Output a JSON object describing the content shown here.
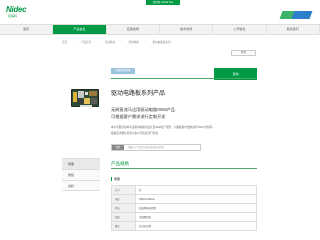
{
  "header": {
    "logo": "Nidec",
    "logo_sub": "尼得科",
    "site_badge": "尼得科 Global Site"
  },
  "nav": {
    "items": [
      {
        "label": "首页",
        "active": false
      },
      {
        "label": "产品信息",
        "active": true
      },
      {
        "label": "应用案例",
        "active": false
      },
      {
        "label": "技术支持",
        "active": false
      },
      {
        "label": "公司信息",
        "active": false
      },
      {
        "label": "联系我们",
        "active": false
      }
    ]
  },
  "breadcrumb": [
    "首页",
    "产品信息",
    "马达驱动",
    "控制电路",
    "驱动电路板系列"
  ],
  "toolbar": {
    "print_label": "打印"
  },
  "product": {
    "category_tag": "控制电路基板",
    "inquiry_label": "咨询",
    "title": "驱动电路板系列产品",
    "headline_1": "无刷直流马达用驱动电路OEM产品",
    "headline_2": "可根据客户需求进行定制开发",
    "desc_1": "本公司提供各种马达驱动电路的设计及OEM生产服务，可根据客户要求进行PWM 控制等。",
    "desc_2": "规格及详细信息请与本公司营业部门咨询。",
    "image_icon": "circuit-board-photo"
  },
  "search": {
    "button_label": "检索",
    "placeholder": "请输入产品型号或关键词进行检索"
  },
  "side_menu": {
    "items": [
      {
        "label": "概要",
        "active": true
      },
      {
        "label": "规格",
        "active": false
      },
      {
        "label": "资料",
        "active": false
      }
    ]
  },
  "spec": {
    "section_title": "产品规格",
    "subsection_title": "概要",
    "rows": [
      {
        "key": "尺寸",
        "value": "约"
      },
      {
        "key": "电压",
        "value": "165mm×90mm"
      },
      {
        "key": "特长",
        "value": "高效率驱动控制"
      },
      {
        "key": "用途",
        "value": "空调用风扇"
      },
      {
        "key": "备注",
        "value": "可对应定制"
      }
    ]
  },
  "colors": {
    "brand_green": "#009944",
    "tag_blue": "#9ec3df",
    "banner_blue": "#2c7fc8"
  }
}
